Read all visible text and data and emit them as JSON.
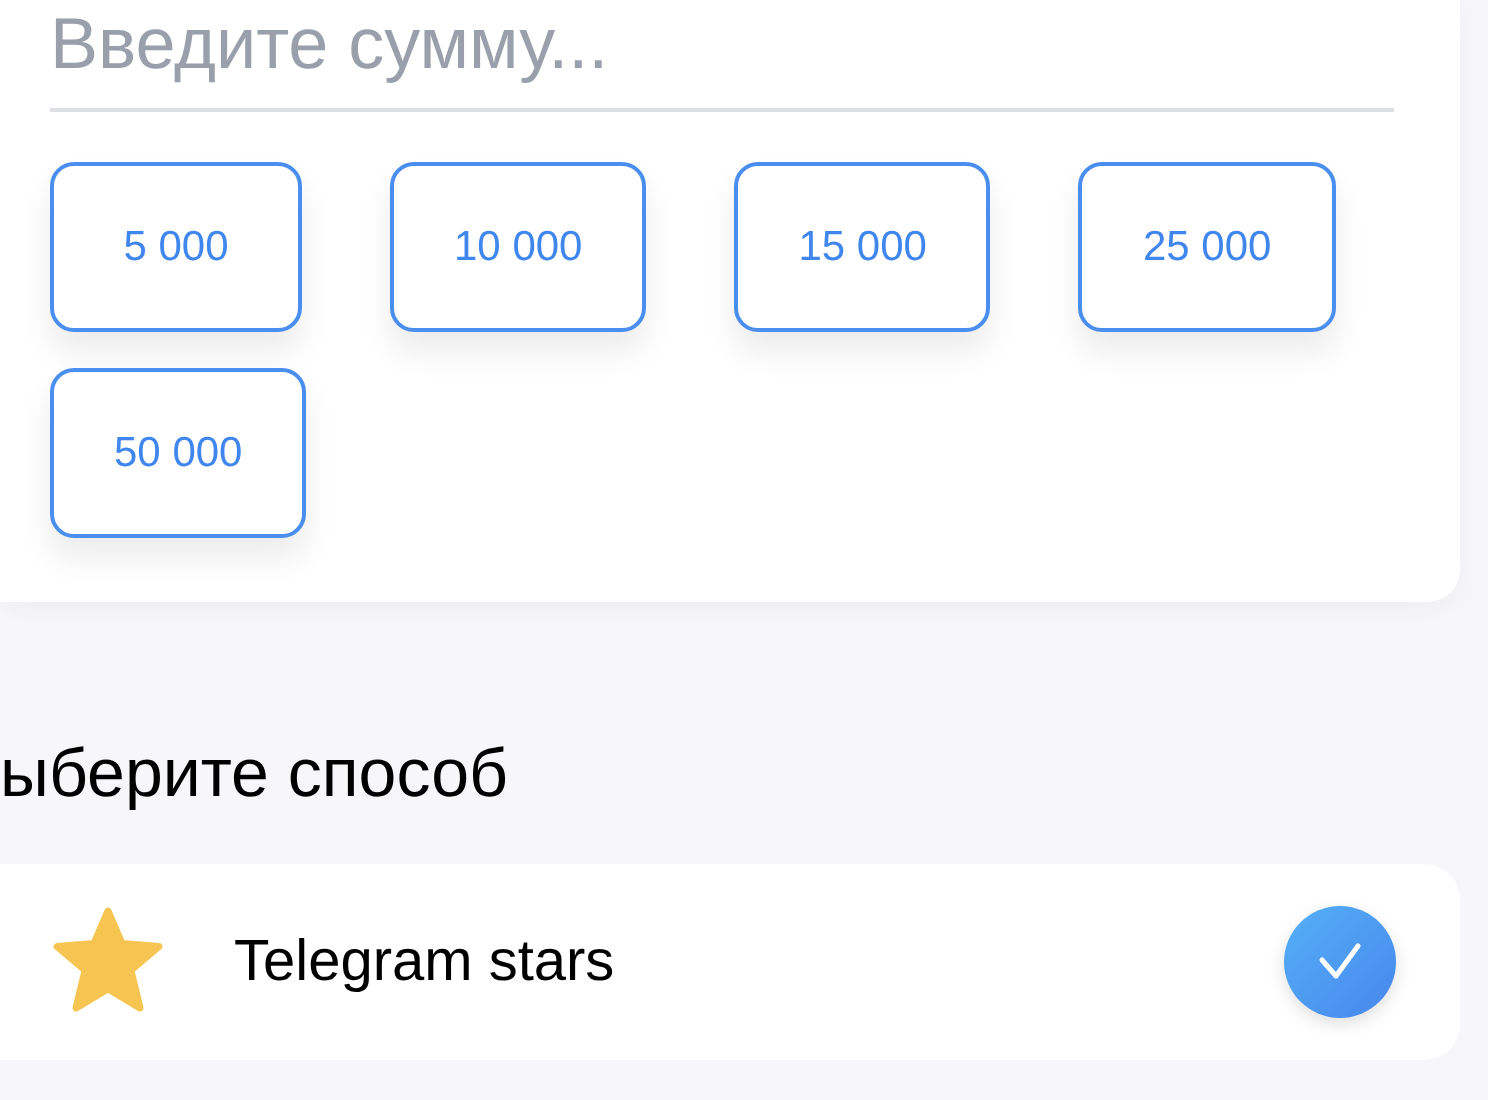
{
  "amount_field": {
    "placeholder": "Введите сумму..."
  },
  "amount_presets": [
    {
      "label": "5 000"
    },
    {
      "label": "10 000"
    },
    {
      "label": "15 000"
    },
    {
      "label": "25 000"
    },
    {
      "label": "50 000"
    }
  ],
  "method_heading": "ыберите способ",
  "methods": [
    {
      "label": "Telegram stars",
      "selected": true
    }
  ]
}
